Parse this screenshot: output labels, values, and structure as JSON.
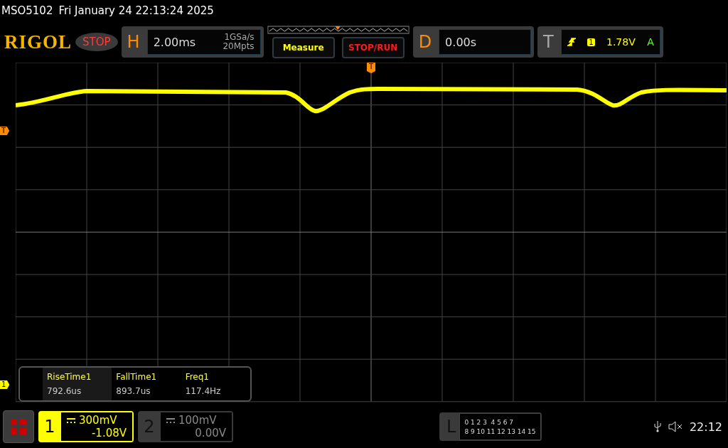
{
  "title_bar": {
    "model": "MSO5102",
    "datetime": "Fri January 24 22:13:24 2025"
  },
  "header": {
    "logo": "RIGOL",
    "run_state": "STOP",
    "horizontal": {
      "letter": "H",
      "timebase": "2.00ms",
      "sample_rate": "1GSa/s",
      "memory_depth": "20Mpts"
    },
    "buttons": [
      {
        "label": "Measure",
        "kind": "measure"
      },
      {
        "label": "STOP/RUN",
        "kind": "run"
      }
    ],
    "delay": {
      "letter": "D",
      "value": "0.00s"
    },
    "trigger": {
      "letter": "T",
      "source": "1",
      "level": "1.78V",
      "mode": "A"
    }
  },
  "markers": {
    "trigger_position": "T",
    "trigger_level": "T",
    "channel": "1"
  },
  "measurements": [
    {
      "label": "RiseTime1",
      "value": "792.6us",
      "selected": true
    },
    {
      "label": "FallTime1",
      "value": "893.7us",
      "selected": false
    },
    {
      "label": "Freq1",
      "value": "117.4Hz",
      "selected": false
    }
  ],
  "channels": [
    {
      "number": "1",
      "scale": "300mV",
      "offset": "-1.08V",
      "on": true
    },
    {
      "number": "2",
      "scale": "100mV",
      "offset": "0.00V",
      "on": false
    }
  ],
  "logic": {
    "letter": "L",
    "rows": [
      "0 1 2 3  4 5 6 7",
      "8 9 10 11 12 13 14 15"
    ]
  },
  "status": {
    "clock": "22:12"
  }
}
